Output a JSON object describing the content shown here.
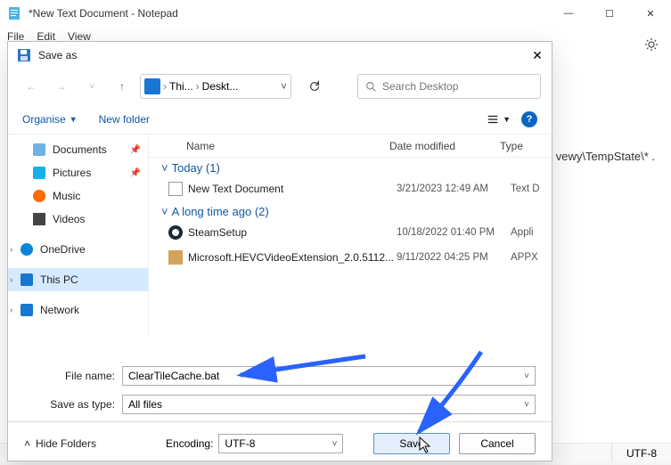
{
  "notepad": {
    "title": "*New Text Document - Notepad",
    "menu": [
      "File",
      "Edit",
      "View"
    ],
    "body_hint": "vewy\\TempState\\* .",
    "status_encoding": "UTF-8"
  },
  "dialog": {
    "title": "Save as",
    "breadcrumb": {
      "p1": "Thi...",
      "p2": "Deskt..."
    },
    "search_placeholder": "Search Desktop",
    "organise": "Organise",
    "new_folder": "New folder",
    "columns": {
      "name": "Name",
      "date": "Date modified",
      "type": "Type"
    },
    "groups": {
      "today": "Today (1)",
      "longago": "A long time ago (2)"
    },
    "files": {
      "f1": {
        "name": "New Text Document",
        "date": "3/21/2023 12:49 AM",
        "type": "Text D"
      },
      "f2": {
        "name": "SteamSetup",
        "date": "10/18/2022 01:40 PM",
        "type": "Appli"
      },
      "f3": {
        "name": "Microsoft.HEVCVideoExtension_2.0.5112...",
        "date": "9/11/2022 04:25 PM",
        "type": "APPX"
      }
    },
    "sidebar": {
      "docs": "Documents",
      "pics": "Pictures",
      "music": "Music",
      "videos": "Videos",
      "onedrive": "OneDrive",
      "pc": "This PC",
      "net": "Network"
    },
    "labels": {
      "filename": "File name:",
      "saveas": "Save as type:",
      "encoding": "Encoding:",
      "hide": "Hide Folders"
    },
    "values": {
      "filename": "ClearTileCache.bat",
      "saveas": "All files",
      "encoding": "UTF-8"
    },
    "buttons": {
      "save": "Save",
      "cancel": "Cancel"
    }
  }
}
